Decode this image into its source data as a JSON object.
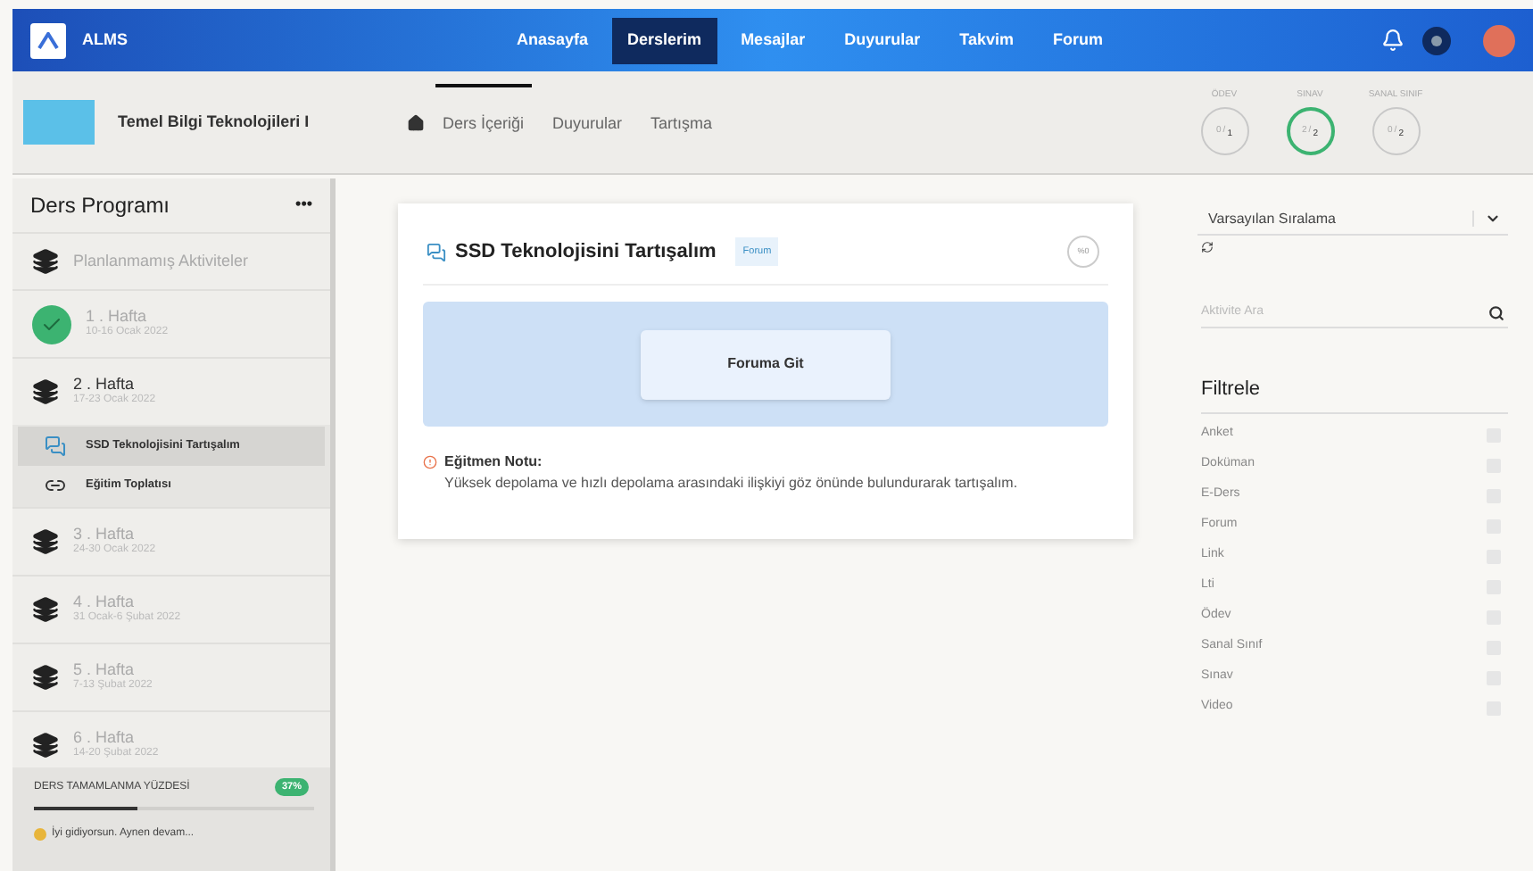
{
  "brand": "ALMS",
  "nav": [
    {
      "label": "Anasayfa",
      "selected": false
    },
    {
      "label": "Derslerim",
      "selected": true
    },
    {
      "label": "Mesajlar",
      "selected": false
    },
    {
      "label": "Duyurular",
      "selected": false
    },
    {
      "label": "Takvim",
      "selected": false
    },
    {
      "label": "Forum",
      "selected": false
    }
  ],
  "course": {
    "title": "Temel Bilgi Teknolojileri I",
    "tabs": [
      {
        "label": "Ders İçeriği",
        "selected": true
      },
      {
        "label": "Duyurular",
        "selected": false
      },
      {
        "label": "Tartışma",
        "selected": false
      }
    ],
    "stats": [
      {
        "label": "ÖDEV",
        "done": "0",
        "sep": "/",
        "total": "1",
        "complete": false
      },
      {
        "label": "SINAV",
        "done": "2",
        "sep": "/",
        "total": "2",
        "complete": true
      },
      {
        "label": "SANAL SINIF",
        "done": "0",
        "sep": "/",
        "total": "2",
        "complete": false
      }
    ]
  },
  "sidebar": {
    "title": "Ders Programı",
    "menu": "•••",
    "items": [
      {
        "kind": "plain",
        "title": "Planlanmamış Aktiviteler",
        "expanded": false
      },
      {
        "kind": "done",
        "title": "1 . Hafta",
        "date": "10-16 Ocak 2022",
        "expanded": false
      },
      {
        "kind": "week",
        "title": "2 . Hafta",
        "date": "17-23 Ocak 2022",
        "expanded": true,
        "children": [
          {
            "kind": "forum",
            "title": "SSD Teknolojisini Tartışalım",
            "selected": true
          },
          {
            "kind": "link",
            "title": "Eğitim Toplatısı",
            "selected": false
          }
        ]
      },
      {
        "kind": "week",
        "title": "3 . Hafta",
        "date": "24-30 Ocak 2022",
        "expanded": false
      },
      {
        "kind": "week",
        "title": "4 . Hafta",
        "date": "31 Ocak-6 Şubat 2022",
        "expanded": false
      },
      {
        "kind": "week",
        "title": "5 . Hafta",
        "date": "7-13 Şubat 2022",
        "expanded": false
      },
      {
        "kind": "week",
        "title": "6 . Hafta",
        "date": "14-20 Şubat 2022",
        "expanded": false
      }
    ],
    "progress": {
      "label": "DERS TAMAMLANMA YÜZDESİ",
      "badge": "37%",
      "level": 0.37,
      "message": "İyi gidiyorsun. Aynen devam..."
    }
  },
  "activity": {
    "title": "SSD Teknolojisini Tartışalım",
    "tag": "Forum",
    "percent": "%0",
    "button": "Foruma Git",
    "note_title": "Eğitmen Notu:",
    "note": "Yüksek depolama ve hızlı depolama arasındaki ilişkiyi göz önünde bulundurarak tartışalım."
  },
  "filters": {
    "sort": "Varsayılan Sıralama",
    "search": {
      "placeholder": "Aktivite Ara"
    },
    "title": "Filtrele",
    "options": [
      {
        "label": "Anket",
        "checked": false
      },
      {
        "label": "Doküman",
        "checked": false
      },
      {
        "label": "E-Ders",
        "checked": false
      },
      {
        "label": "Forum",
        "checked": false
      },
      {
        "label": "Link",
        "checked": false
      },
      {
        "label": "Lti",
        "checked": false
      },
      {
        "label": "Ödev",
        "checked": false
      },
      {
        "label": "Sanal Sınıf",
        "checked": false
      },
      {
        "label": "Sınav",
        "checked": false
      },
      {
        "label": "Video",
        "checked": false
      }
    ]
  }
}
